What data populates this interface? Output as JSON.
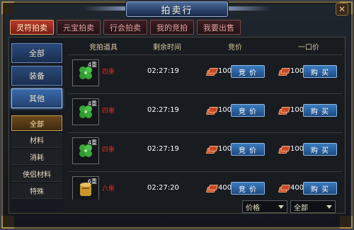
{
  "window": {
    "title": "拍卖行",
    "close_glyph": "✕"
  },
  "tabs": [
    {
      "label": "灵符拍卖",
      "active": true
    },
    {
      "label": "元宝拍卖",
      "active": false
    },
    {
      "label": "行会拍卖",
      "active": false
    },
    {
      "label": "我的竞拍",
      "active": false
    },
    {
      "label": "我要出售",
      "active": false
    }
  ],
  "sidebar": {
    "categories": [
      {
        "label": "全部",
        "active": false
      },
      {
        "label": "装备",
        "active": false
      },
      {
        "label": "其他",
        "active": true
      }
    ],
    "subcategories": [
      {
        "label": "全部",
        "active": true
      },
      {
        "label": "材料",
        "active": false
      },
      {
        "label": "消耗",
        "active": false
      },
      {
        "label": "侠侣材料",
        "active": false
      },
      {
        "label": "特殊",
        "active": false
      }
    ]
  },
  "table": {
    "headers": {
      "item": "竞拍道具",
      "time": "剩余时间",
      "bid": "竞价",
      "buyout": "一口价"
    },
    "rows": [
      {
        "icon": "clover-icon",
        "qty": "4重",
        "tag": "四重",
        "time": "02:27:19",
        "bid_price": "100",
        "bid_label": "竞 价",
        "buy_price": "100",
        "buy_label": "购 买"
      },
      {
        "icon": "clover-icon",
        "qty": "4重",
        "tag": "四重",
        "time": "02:27:19",
        "bid_price": "100",
        "bid_label": "竞 价",
        "buy_price": "100",
        "buy_label": "购 买"
      },
      {
        "icon": "clover-icon",
        "qty": "4重",
        "tag": "四重",
        "time": "02:27:19",
        "bid_price": "100",
        "bid_label": "竞 价",
        "buy_price": "100",
        "buy_label": "购 买"
      },
      {
        "icon": "scroll-icon",
        "qty": "6重",
        "tag": "六重",
        "time": "02:27:20",
        "bid_price": "400",
        "bid_label": "竞 价",
        "buy_price": "400",
        "buy_label": "购 买"
      }
    ]
  },
  "filters": {
    "sort": "价格",
    "filter": "全部"
  },
  "colors": {
    "accent_red": "#b83a2a",
    "button_blue": "#3a7abe",
    "tag_red": "#e02a1a"
  }
}
